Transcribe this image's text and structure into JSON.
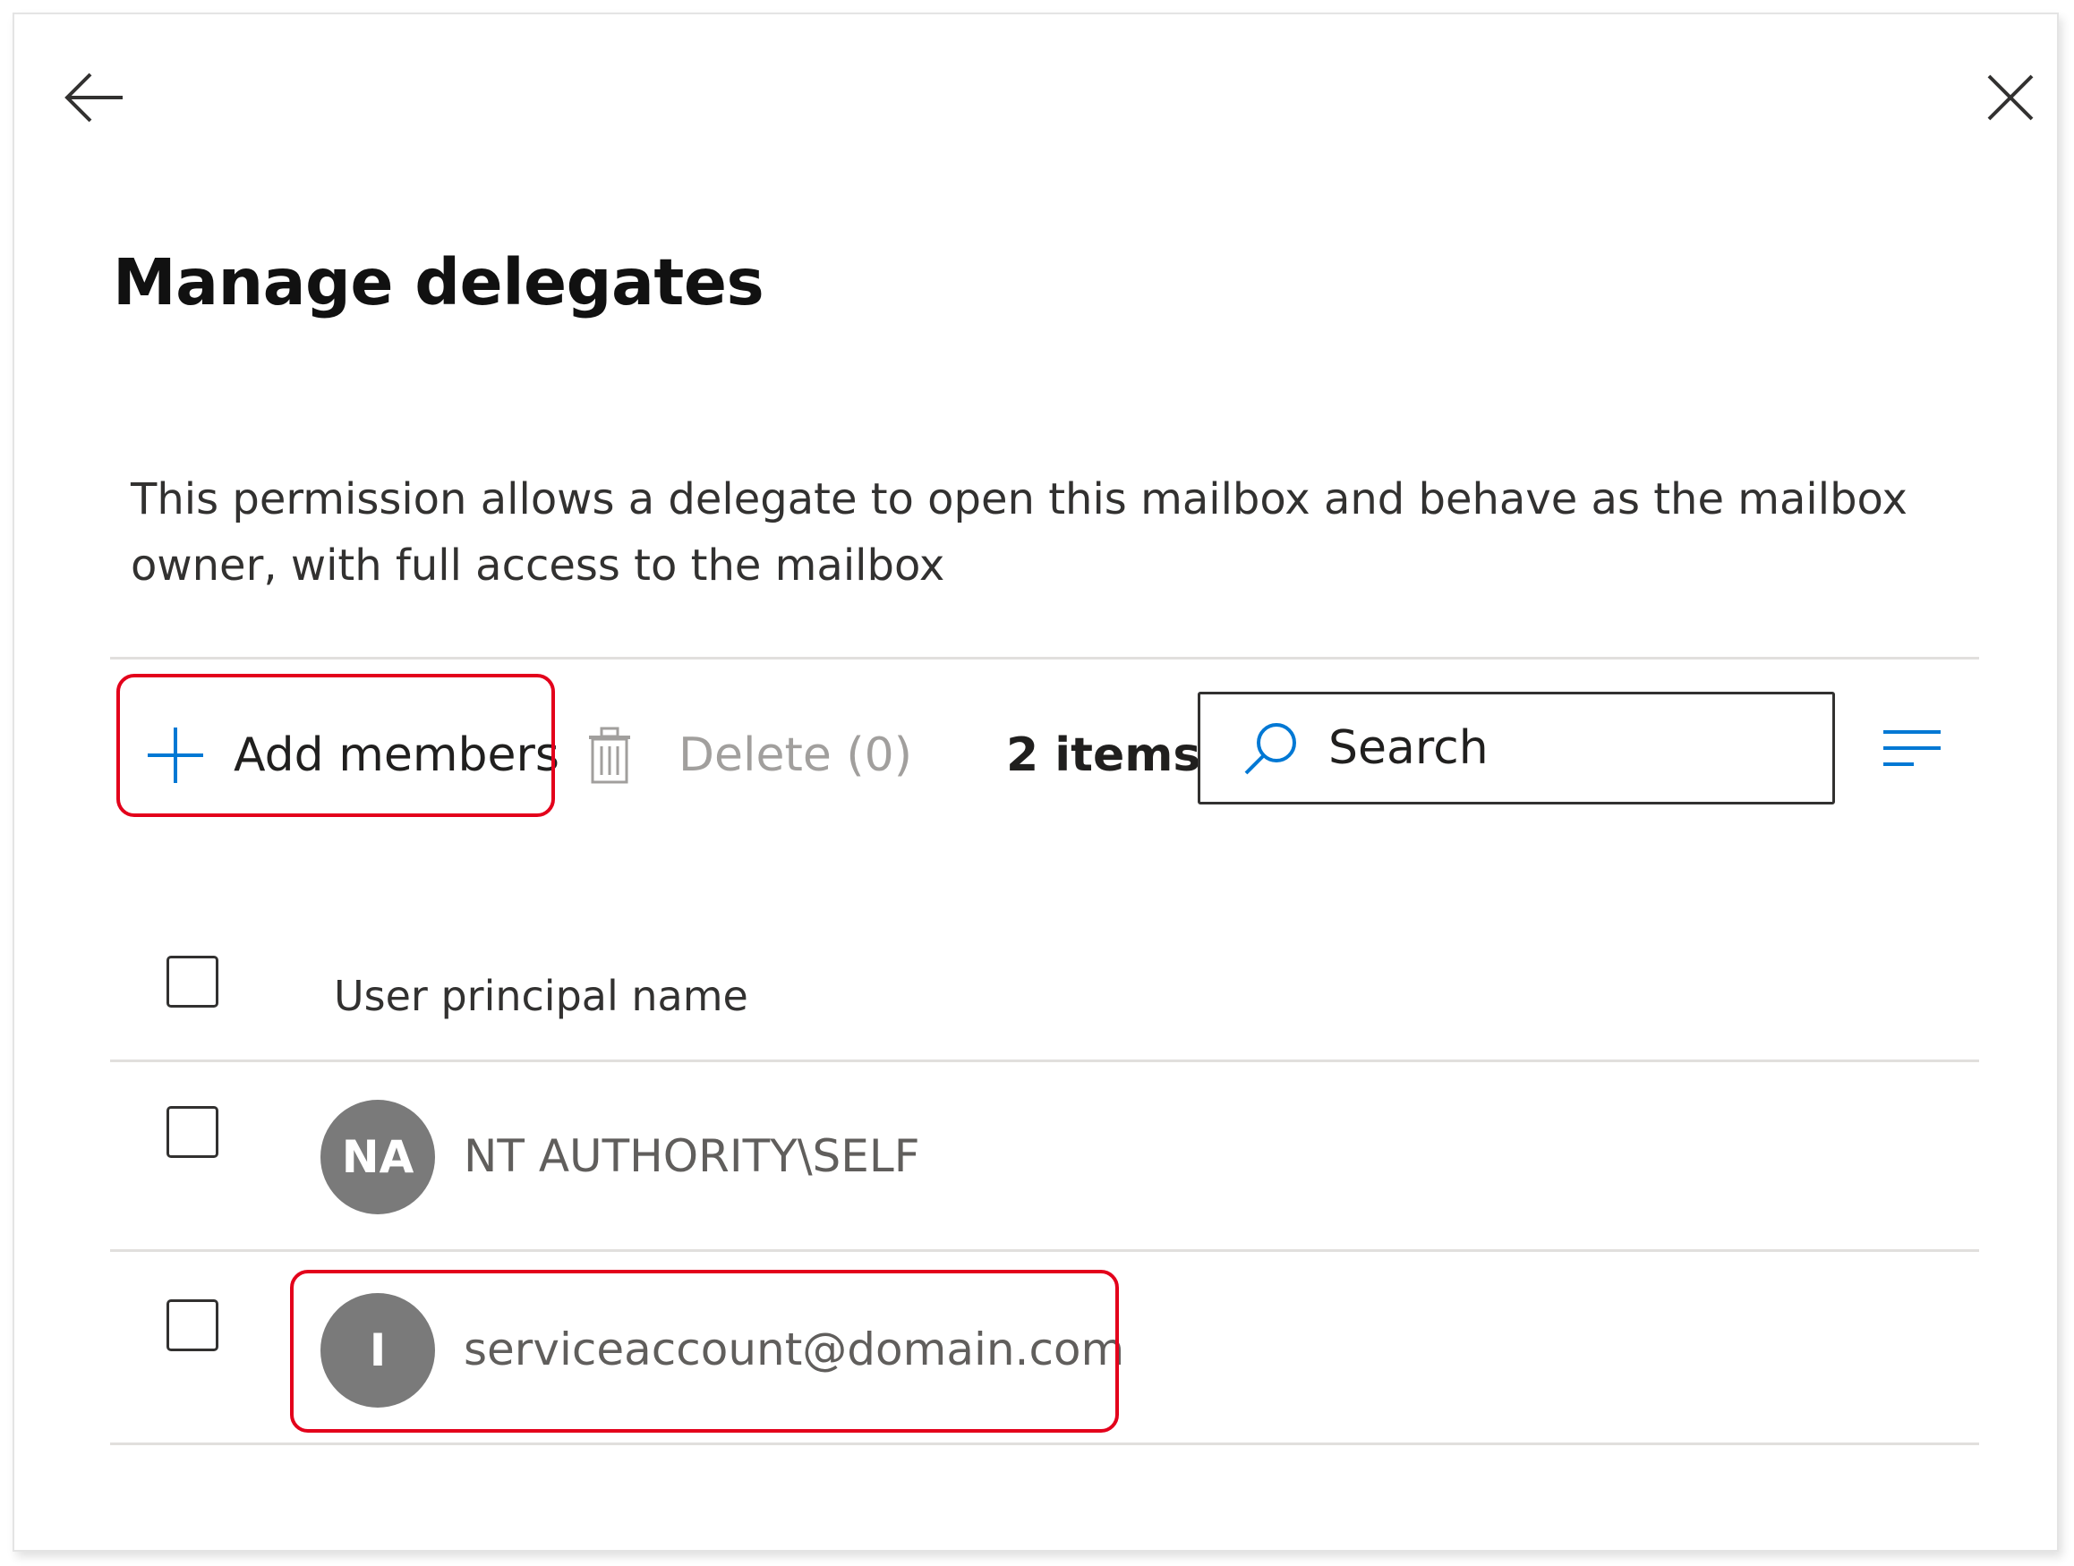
{
  "header": {
    "back_icon": "arrow-left-icon",
    "close_icon": "close-icon"
  },
  "title": "Manage delegates",
  "description": "This permission allows a delegate to open this mailbox and behave as the mailbox owner, with full access to the mailbox",
  "toolbar": {
    "add_label": "Add members",
    "delete_label": "Delete (0)",
    "items_count": "2 items",
    "search_placeholder": "Search"
  },
  "table": {
    "column_header": "User principal name",
    "rows": [
      {
        "initials": "NA",
        "name": "NT AUTHORITY\\SELF"
      },
      {
        "initials": "I",
        "name": "serviceaccount@domain.com"
      }
    ]
  },
  "colors": {
    "highlight": "#e3001b",
    "accent": "#0078d4",
    "avatar": "#7a7a7a"
  }
}
